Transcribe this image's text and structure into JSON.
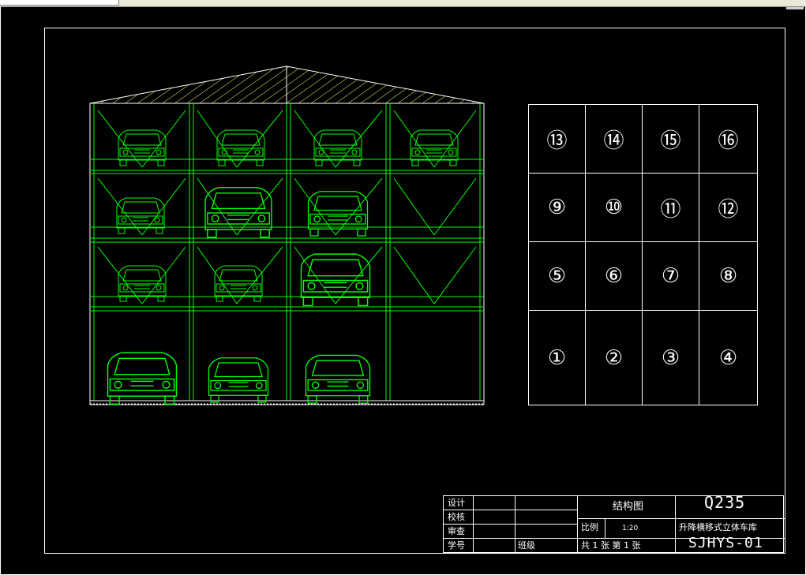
{
  "grid": {
    "rows": [
      [
        "⑬",
        "⑭",
        "⑮",
        "⑯"
      ],
      [
        "⑨",
        "⑩",
        "⑪",
        "⑫"
      ],
      [
        "⑤",
        "⑥",
        "⑦",
        "⑧"
      ],
      [
        "①",
        "②",
        "③",
        "④"
      ]
    ]
  },
  "title_block": {
    "design": "设计",
    "check": "校核",
    "review": "审查",
    "student_no": "学号",
    "class": "班级",
    "drawing_name": "结构图",
    "material": "Q235",
    "scale_label": "比例",
    "scale_value": "1:20",
    "sheet_info": "共 1 张 第 1 张",
    "product_name": "升降横移式立体车库",
    "drawing_no": "SJHYS-01"
  },
  "colors": {
    "background": "#000000",
    "lines": "#ffffff",
    "structure": "#00ff00",
    "roof": "#ffff00"
  }
}
